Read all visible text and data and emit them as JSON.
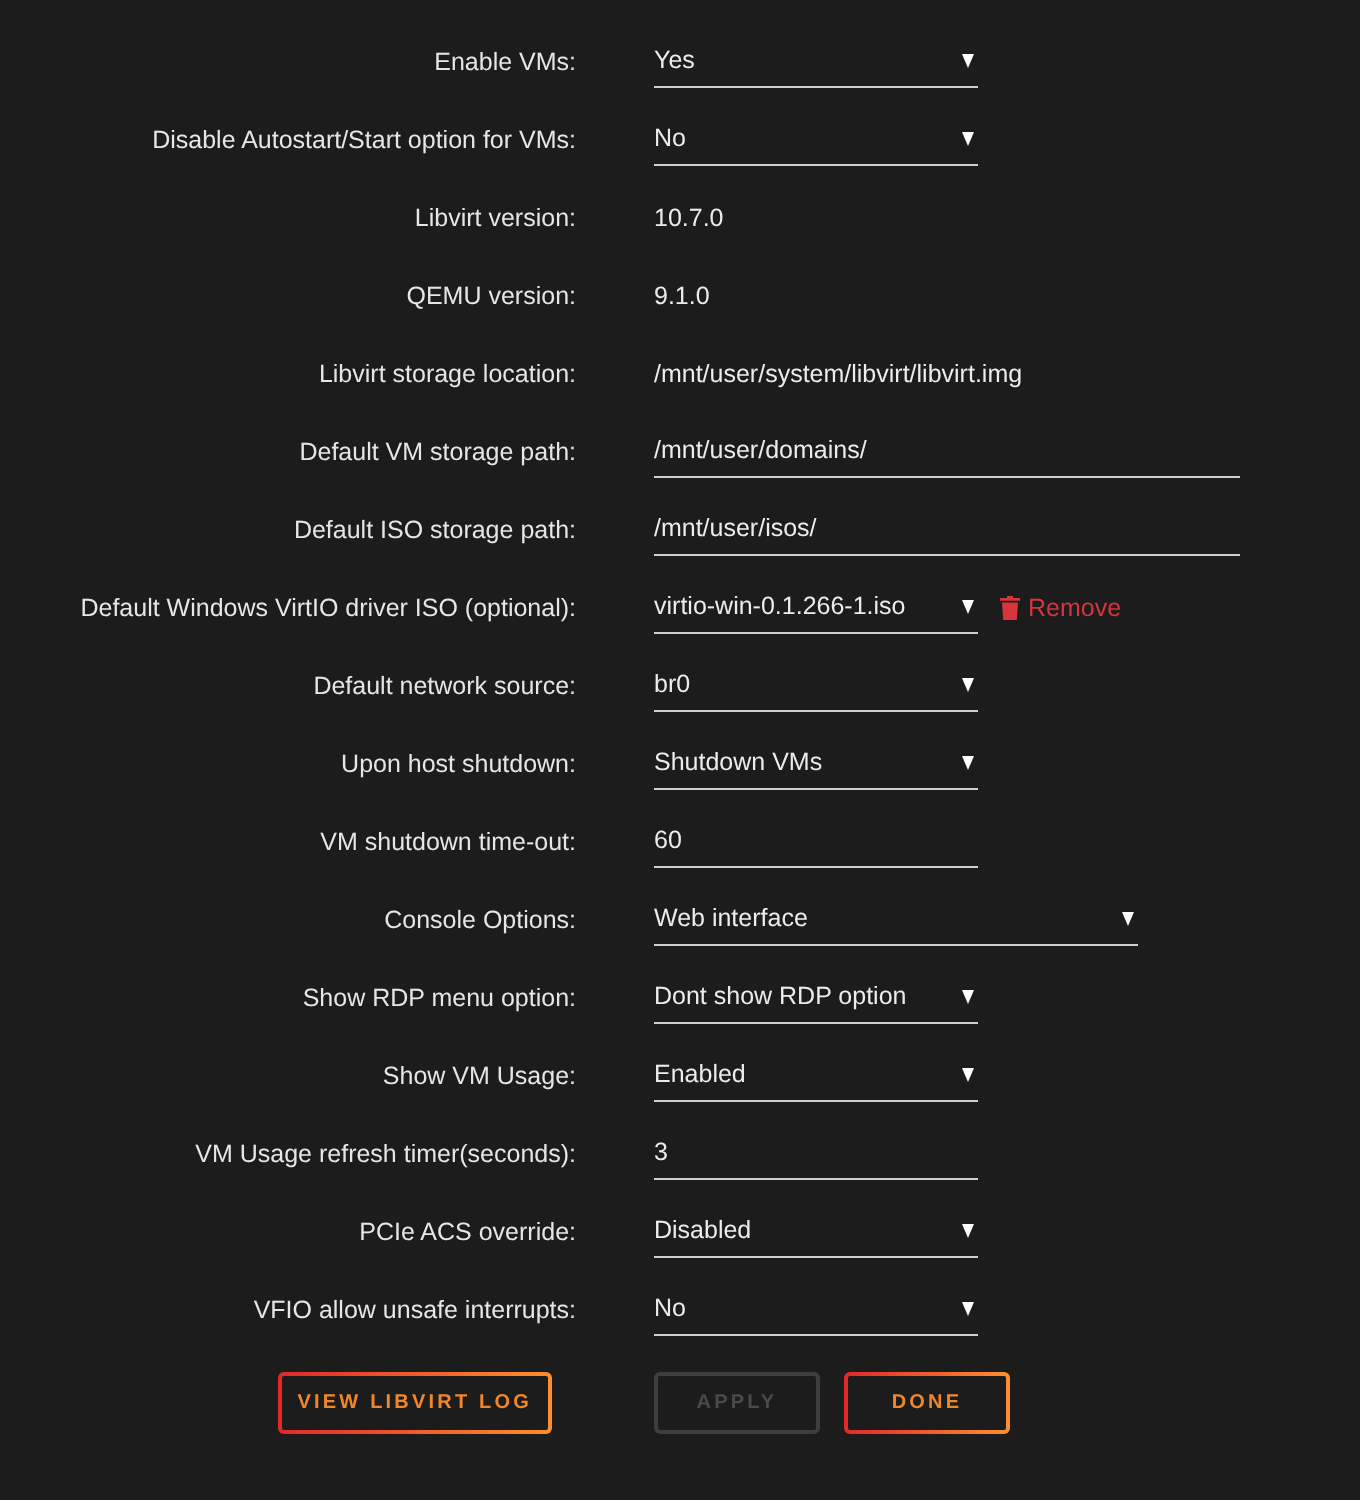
{
  "settings": [
    {
      "label": "Enable VMs:",
      "kind": "select",
      "value": "Yes"
    },
    {
      "label": "Disable Autostart/Start option for VMs:",
      "kind": "select",
      "value": "No"
    },
    {
      "label": "Libvirt version:",
      "kind": "static",
      "value": "10.7.0"
    },
    {
      "label": "QEMU version:",
      "kind": "static",
      "value": "9.1.0"
    },
    {
      "label": "Libvirt storage location:",
      "kind": "static",
      "value": "/mnt/user/system/libvirt/libvirt.img"
    },
    {
      "label": "Default VM storage path:",
      "kind": "path",
      "value": "/mnt/user/domains/"
    },
    {
      "label": "Default ISO storage path:",
      "kind": "path",
      "value": "/mnt/user/isos/"
    },
    {
      "label": "Default Windows VirtIO driver ISO (optional):",
      "kind": "select",
      "value": "virtio-win-0.1.266-1.iso",
      "action": "Remove"
    },
    {
      "label": "Default network source:",
      "kind": "select",
      "value": "br0"
    },
    {
      "label": "Upon host shutdown:",
      "kind": "select",
      "value": "Shutdown VMs"
    },
    {
      "label": "VM shutdown time-out:",
      "kind": "input",
      "value": "60"
    },
    {
      "label": "Console Options:",
      "kind": "wide_select",
      "value": "Web interface"
    },
    {
      "label": "Show RDP menu option:",
      "kind": "select",
      "value": "Dont show RDP option"
    },
    {
      "label": "Show VM Usage:",
      "kind": "select",
      "value": "Enabled"
    },
    {
      "label": "VM Usage refresh timer(seconds):",
      "kind": "input",
      "value": "3"
    },
    {
      "label": "PCIe ACS override:",
      "kind": "select",
      "value": "Disabled"
    },
    {
      "label": "VFIO allow unsafe interrupts:",
      "kind": "select",
      "value": "No"
    }
  ],
  "buttons": [
    {
      "label": "VIEW LIBVIRT LOG",
      "disabled": false
    },
    {
      "label": "APPLY",
      "disabled": true
    },
    {
      "label": "DONE",
      "disabled": false
    }
  ]
}
